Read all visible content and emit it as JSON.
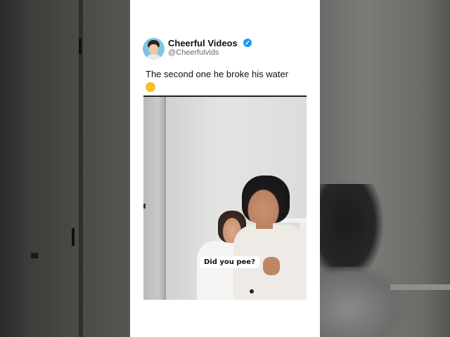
{
  "post": {
    "author_name": "Cheerful Videos",
    "verified_icon": "verified-badge-icon",
    "author_handle": "@Cheerfulvids",
    "text": "The second one he broke his water",
    "emoji": "😂",
    "video_caption": "Did you pee?"
  },
  "colors": {
    "card_background": "#ffffff",
    "verified_badge": "#1d9bf0",
    "handle_text": "#6b6b6b"
  }
}
